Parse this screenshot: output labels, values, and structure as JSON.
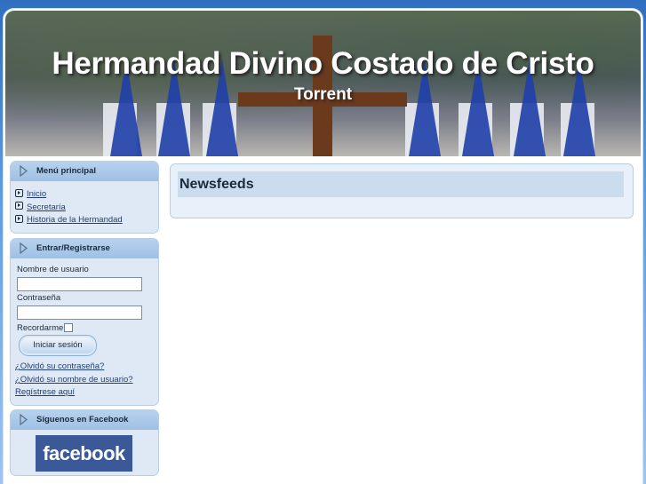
{
  "banner": {
    "title": "Hermandad Divino Costado de Cristo",
    "subtitle": "Torrent"
  },
  "menu_principal": {
    "title": "Menú principal",
    "items": [
      {
        "label": "Inicio"
      },
      {
        "label": "Secretaría"
      },
      {
        "label": "Historia de la Hermandad"
      }
    ]
  },
  "login": {
    "title": "Entrar/Registrarse",
    "username_label": "Nombre de usuario",
    "username_value": "",
    "password_label": "Contraseña",
    "password_value": "",
    "remember_label": "Recordarme",
    "submit_label": "Iniciar sesión",
    "forgot_password": "¿Olvidó su contraseña?",
    "forgot_username": "¿Olvidó su nombre de usuario?",
    "register": "Regístrese aquí"
  },
  "facebook": {
    "title": "Síguenos en Facebook",
    "logo_text": "facebook"
  },
  "main": {
    "title": "Newsfeeds"
  },
  "colors": {
    "page_background": "#2f6ec0",
    "module_background": "#dfe9f5",
    "module_header": "#b7d2ee",
    "link": "#1f3e73",
    "facebook_blue": "#3b5998"
  }
}
